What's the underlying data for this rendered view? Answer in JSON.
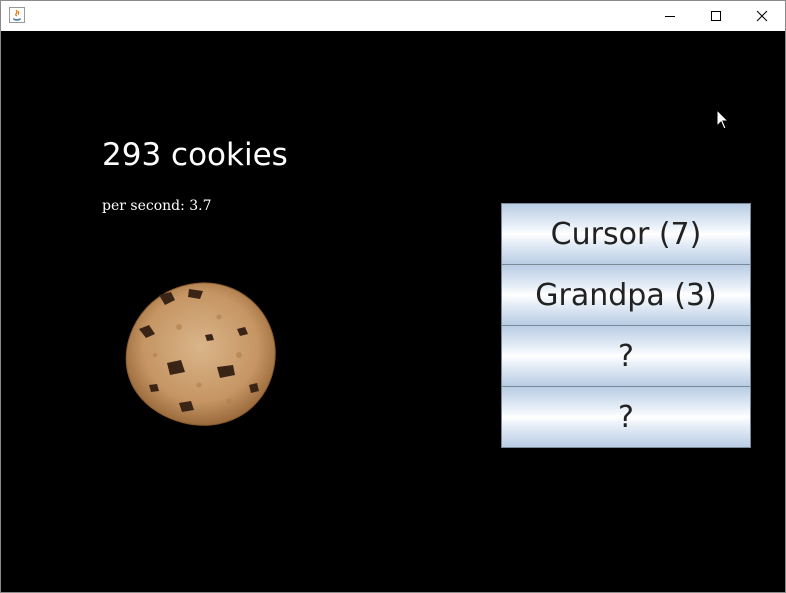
{
  "window": {
    "title": "",
    "icon": "java-icon",
    "controls": [
      "minimize-icon",
      "maximize-icon",
      "close-icon"
    ]
  },
  "game": {
    "cookie_count_text": "293 cookies",
    "per_second_text": "per second: 3.7",
    "cookie_icon": "cookie-image"
  },
  "shop": {
    "items": [
      {
        "label": "Cursor (7)"
      },
      {
        "label": "Grandpa (3)"
      },
      {
        "label": "?"
      },
      {
        "label": "?"
      }
    ]
  },
  "colors": {
    "background": "#000000",
    "text": "#ffffff",
    "button_gradient_edge": "#b9cde4",
    "button_gradient_center": "#ffffff"
  }
}
